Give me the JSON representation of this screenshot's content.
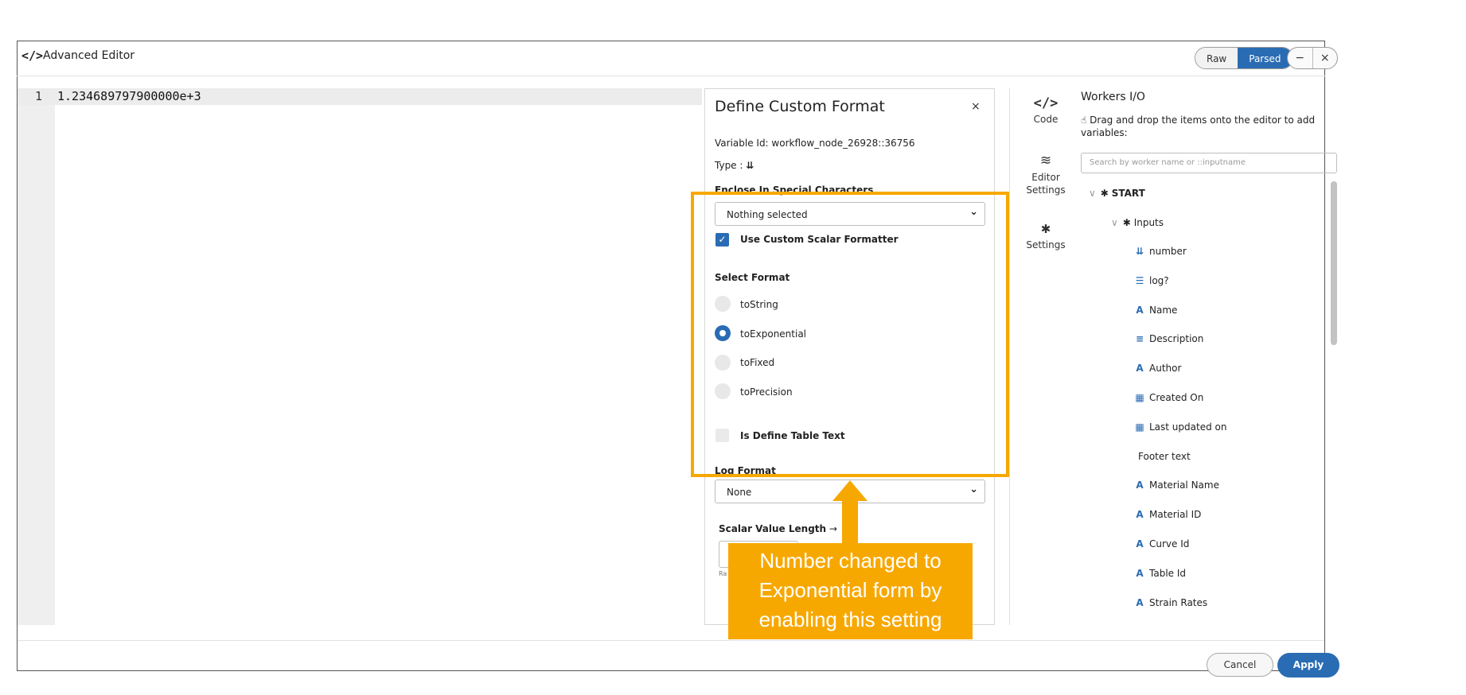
{
  "window": {
    "title": "Advanced Editor",
    "icon": "code-icon",
    "view_toggle": {
      "raw": "Raw",
      "parsed": "Parsed",
      "active": "Parsed"
    },
    "minimize": "−",
    "close": "×"
  },
  "editor": {
    "line_number": "1",
    "code": "1.234689797900000e+3"
  },
  "custom_format": {
    "title": "Define Custom Format",
    "close": "×",
    "variable_id": "Variable Id: workflow_node_26928::36756",
    "type_label": "Type :",
    "type_icon": "⇊",
    "enclose_label": "Enclose In Special Characters",
    "enclose_value": "Nothing selected",
    "use_custom_scalar": "Use Custom Scalar Formatter",
    "use_custom_scalar_checked": true,
    "select_format_label": "Select Format",
    "formats": [
      {
        "label": "toString",
        "selected": false
      },
      {
        "label": "toExponential",
        "selected": true
      },
      {
        "label": "toFixed",
        "selected": false
      },
      {
        "label": "toPrecision",
        "selected": false
      }
    ],
    "is_define_table_text": "Is Define Table Text",
    "is_define_table_text_checked": false,
    "log_format_label": "Log Format",
    "log_format_value": "None",
    "scalar_value_length": "Scalar Value Length",
    "scalar_arrow": "→",
    "scalar_hint": "Ra"
  },
  "tools": [
    {
      "icon": "code-icon",
      "glyph": "</>",
      "label": "Code"
    },
    {
      "icon": "sliders-icon",
      "glyph": "≋",
      "label": "Editor Settings"
    },
    {
      "icon": "gear-icon",
      "glyph": "✱",
      "label": "Settings"
    }
  ],
  "workers_io": {
    "title": "Workers I/O",
    "hint": "Drag and drop the items onto the editor to add variables:",
    "search_placeholder": "Search by worker name or ::inputname",
    "tree": {
      "root": "START",
      "group": "Inputs",
      "items": [
        {
          "icon": "number-icon",
          "glyph": "⇊",
          "label": "number"
        },
        {
          "icon": "list-icon",
          "glyph": "☰",
          "label": "log?"
        },
        {
          "icon": "text-icon",
          "glyph": "A",
          "label": "Name"
        },
        {
          "icon": "paragraph-icon",
          "glyph": "≡",
          "label": "Description"
        },
        {
          "icon": "text-icon",
          "glyph": "A",
          "label": "Author"
        },
        {
          "icon": "calendar-icon",
          "glyph": "▦",
          "label": "Created On"
        },
        {
          "icon": "calendar-icon",
          "glyph": "▦",
          "label": "Last updated on"
        },
        {
          "icon": "",
          "glyph": "",
          "label": "Footer text"
        },
        {
          "icon": "text-icon",
          "glyph": "A",
          "label": "Material Name"
        },
        {
          "icon": "text-icon",
          "glyph": "A",
          "label": "Material ID"
        },
        {
          "icon": "text-icon",
          "glyph": "A",
          "label": "Curve Id"
        },
        {
          "icon": "text-icon",
          "glyph": "A",
          "label": "Table Id"
        },
        {
          "icon": "text-icon",
          "glyph": "A",
          "label": "Strain Rates"
        }
      ]
    }
  },
  "footer": {
    "cancel": "Cancel",
    "apply": "Apply"
  },
  "annotation": {
    "callout_lines": [
      "Number changed to",
      "Exponential form by",
      "enabling this setting"
    ]
  },
  "colors": {
    "accent": "#2a6cb3",
    "annotation": "#f7a800"
  }
}
